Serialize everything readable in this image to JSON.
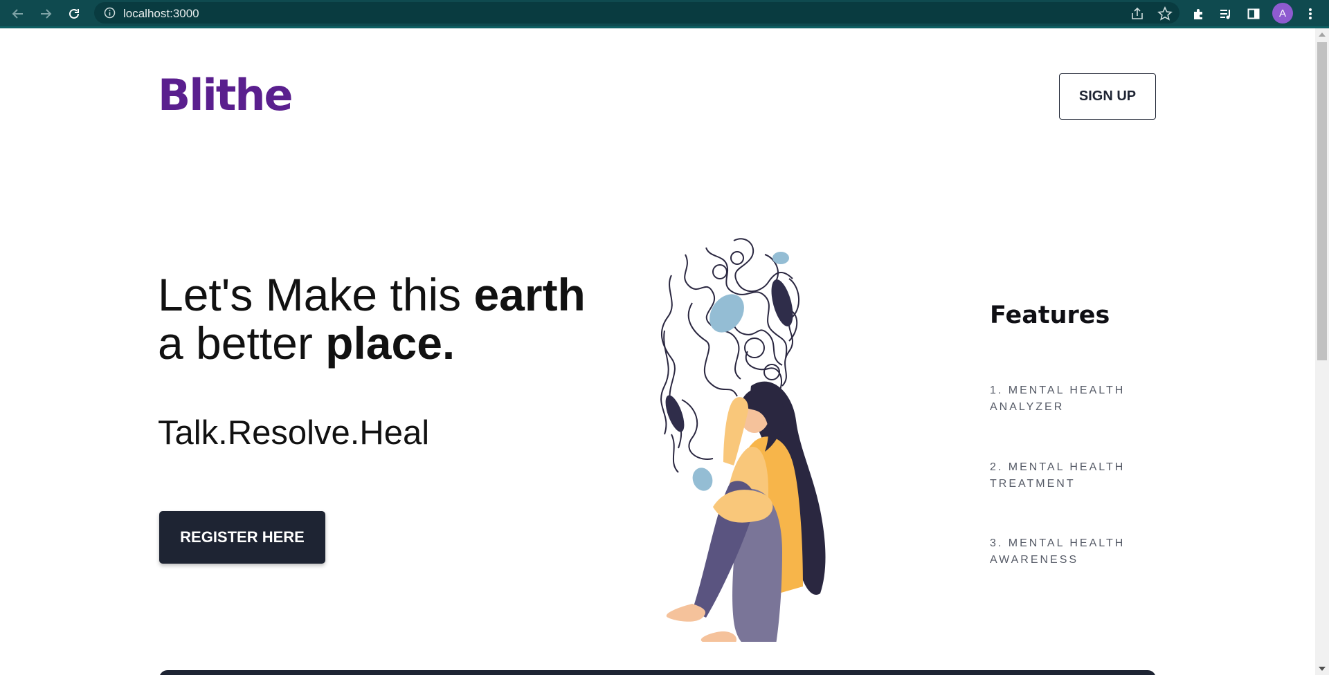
{
  "browser": {
    "url": "localhost:3000",
    "avatar_letter": "A"
  },
  "header": {
    "logo": "Blithe",
    "signup_label": "SIGN UP"
  },
  "hero": {
    "line1_regular": "Let's Make this ",
    "line1_bold": "earth",
    "line2_regular": "a better ",
    "line2_bold": "place.",
    "tagline": "Talk.Resolve.Heal",
    "register_label": "REGISTER HERE"
  },
  "features": {
    "title": "Features",
    "items": [
      {
        "line1": "1. MENTAL HEALTH",
        "line2": "ANALYZER"
      },
      {
        "line1": "2. MENTAL HEALTH",
        "line2": "TREATMENT"
      },
      {
        "line1": "3. MENTAL HEALTH",
        "line2": "AWARENESS"
      }
    ]
  },
  "colors": {
    "brand": "#5a1f8e",
    "dark_button": "#1e2433",
    "chrome": "#0f4a4f"
  }
}
